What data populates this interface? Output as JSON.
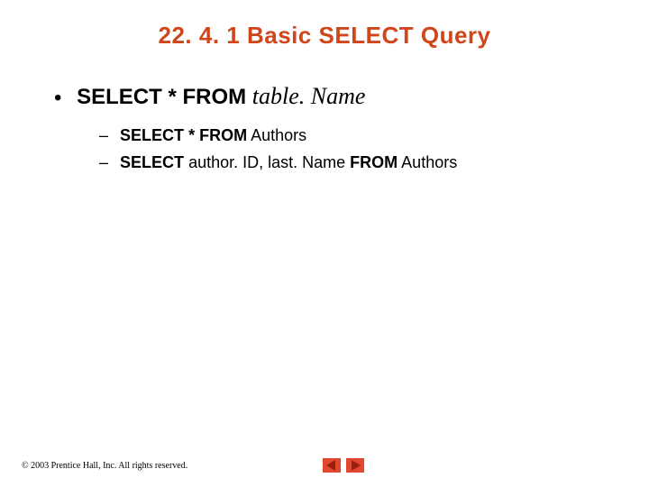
{
  "title": "22. 4. 1 Basic SELECT Query",
  "bullet": {
    "kw1": "SELECT",
    "star": "*",
    "kw2": "FROM",
    "italic": "table. Name"
  },
  "subs": {
    "s1": {
      "kw1": "SELECT",
      "star": "*",
      "kw2": "FROM",
      "rest": "Authors"
    },
    "s2": {
      "kw1": "SELECT",
      "mid": "author. ID, last. Name",
      "kw2": "FROM",
      "rest": "Authors"
    }
  },
  "copyright": "© 2003 Prentice Hall, Inc.  All rights reserved."
}
